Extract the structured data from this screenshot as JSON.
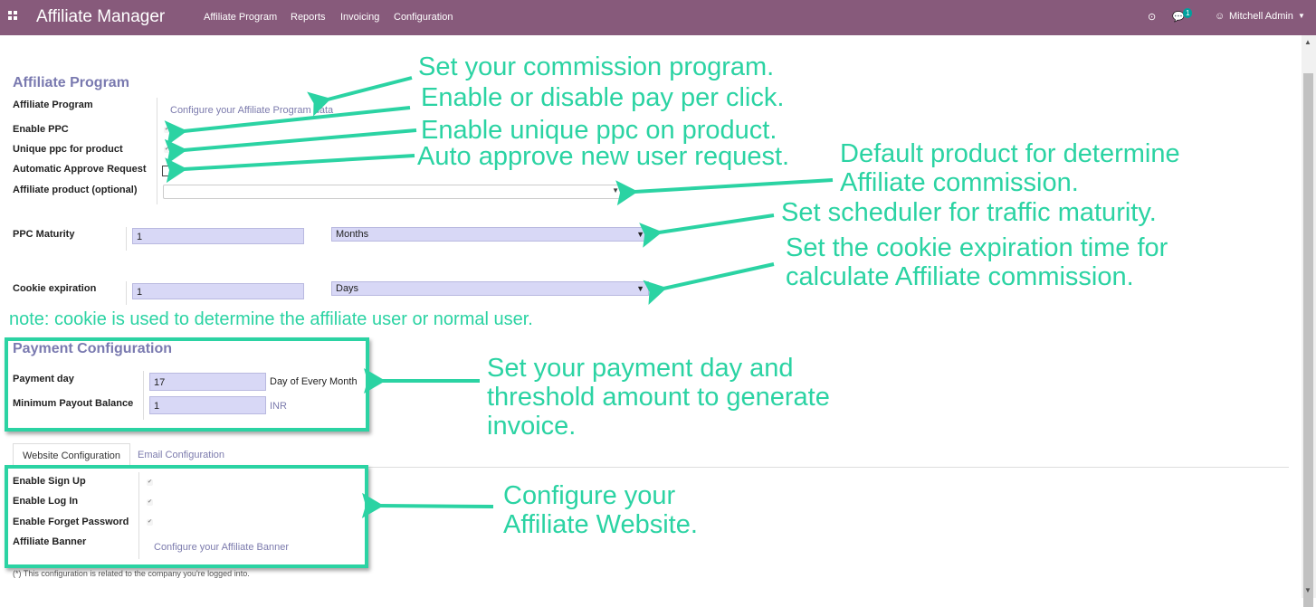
{
  "navbar": {
    "app_name": "Affiliate Manager",
    "menu": [
      "Affiliate Program",
      "Reports",
      "Invoicing",
      "Configuration"
    ],
    "chat_count": "1",
    "user": "Mitchell Admin"
  },
  "affiliate_program": {
    "title": "Affiliate Program",
    "rows": [
      {
        "label": "Affiliate Program",
        "value": "Configure your Affiliate Program data"
      },
      {
        "label": "Enable PPC",
        "checked": true
      },
      {
        "label": "Unique ppc for product",
        "checked": true
      },
      {
        "label": "Automatic Approve Request",
        "checked": false
      },
      {
        "label": "Affiliate product (optional)",
        "value": ""
      }
    ],
    "ppc_maturity": {
      "label": "PPC Maturity",
      "value": "1",
      "unit": "Months"
    },
    "cookie_expiration": {
      "label": "Cookie expiration",
      "value": "1",
      "unit": "Days"
    }
  },
  "payment": {
    "title": "Payment Configuration",
    "payment_day": {
      "label": "Payment day",
      "value": "17",
      "suffix": "Day of Every Month"
    },
    "min_payout": {
      "label": "Minimum Payout Balance",
      "value": "1",
      "suffix": "INR"
    }
  },
  "tabs": [
    "Website Configuration",
    "Email Configuration"
  ],
  "website": {
    "rows": [
      {
        "label": "Enable Sign Up",
        "checked": true
      },
      {
        "label": "Enable Log In",
        "checked": true
      },
      {
        "label": "Enable Forget Password",
        "checked": true
      },
      {
        "label": "Affiliate Banner",
        "value": "Configure your Affiliate Banner"
      }
    ]
  },
  "footnote": "(*) This configuration is related to the company you're logged into.",
  "annotations": {
    "a1": "Set your commission program.",
    "a2": "Enable or disable pay per click.",
    "a3": "Enable unique ppc on product.",
    "a4": "Auto approve new user request.",
    "a5_line1": "Default product for determine",
    "a5_line2": "Affiliate commission.",
    "a6": "Set scheduler for traffic maturity.",
    "a7_line1": "Set the cookie expiration time for",
    "a7_line2": "calculate Affiliate commission.",
    "note": "note: cookie is used to determine the affiliate user or normal user.",
    "a8_line1": "Set your payment day and",
    "a8_line2": "threshold amount to generate",
    "a8_line3": "invoice.",
    "a9_line1": "Configure your",
    "a9_line2": "Affiliate Website."
  },
  "colors": {
    "navbar": "#875a7b",
    "annotation": "#2bd3a3",
    "field": "#d8d8f6",
    "accent": "#7c7bad"
  }
}
